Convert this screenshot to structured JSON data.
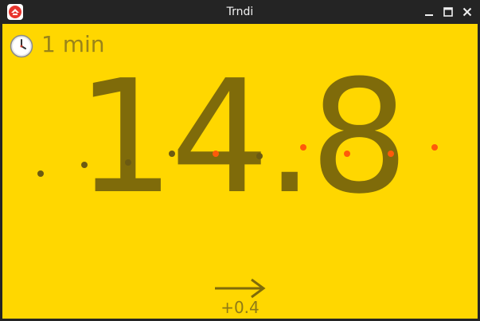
{
  "window": {
    "title": "Trndi",
    "icon": "app-logo-icon"
  },
  "controls": {
    "minimize_icon": "minimize-icon",
    "maximize_icon": "maximize-icon",
    "close_icon": "close-icon"
  },
  "display": {
    "interval_icon": "clock-icon",
    "interval_text": "1 min",
    "reading": "14.8",
    "trend_icon": "arrow-right-icon",
    "delta": "+0.4"
  },
  "colors": {
    "background": "#ffd700",
    "reading_text": "#7f6b0a",
    "dot_normal": "#6b5a12",
    "dot_high": "#ff5a0a"
  },
  "history_points": [
    {
      "status": "normal"
    },
    {
      "status": "normal"
    },
    {
      "status": "normal"
    },
    {
      "status": "normal"
    },
    {
      "status": "high"
    },
    {
      "status": "normal"
    },
    {
      "status": "high"
    },
    {
      "status": "high"
    },
    {
      "status": "high"
    },
    {
      "status": "high"
    }
  ]
}
